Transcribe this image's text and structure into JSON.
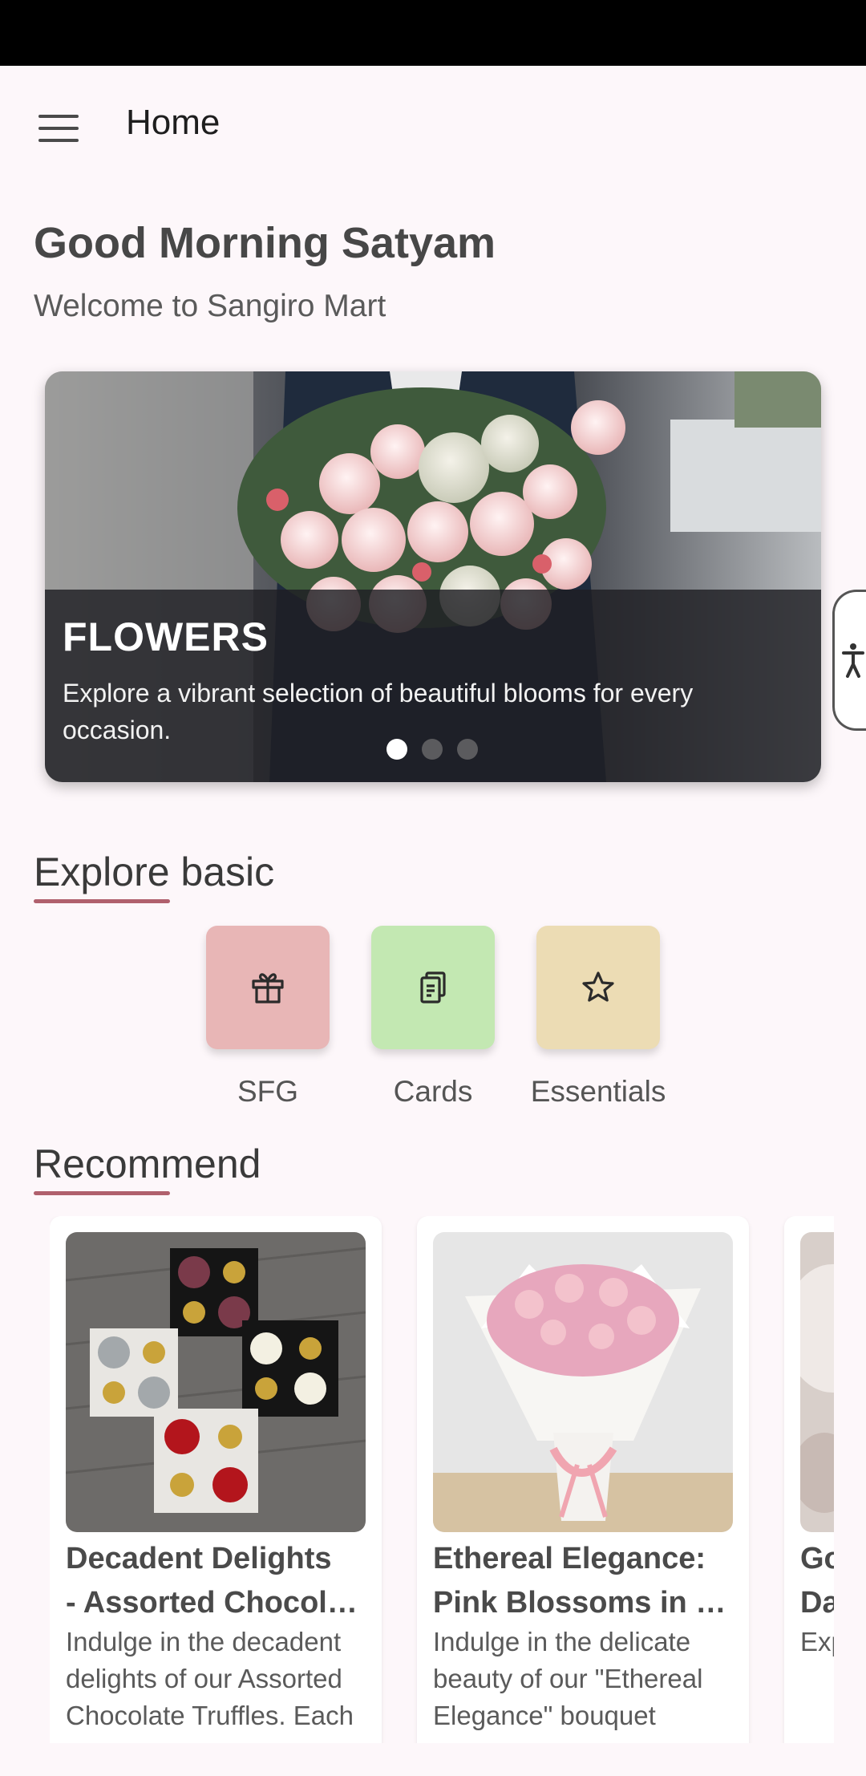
{
  "app_bar": {
    "title": "Home",
    "menu_icon": "hamburger-menu-icon"
  },
  "header": {
    "greeting": "Good Morning Satyam",
    "subtitle": "Welcome to Sangiro Mart"
  },
  "banner": {
    "title": "FLOWERS",
    "description": "Explore a vibrant selection of beautiful blooms for every occasion.",
    "slide_count": 3,
    "active_slide": 1
  },
  "explore": {
    "title": "Explore basic",
    "items": [
      {
        "label": "SFG",
        "icon": "gift-icon",
        "color": "#e8b6b6"
      },
      {
        "label": "Cards",
        "icon": "clipboard-icon",
        "color": "#c3e8b2"
      },
      {
        "label": "Essentials",
        "icon": "star-icon",
        "color": "#ecdcb4"
      }
    ]
  },
  "recommend": {
    "title": "Recommend",
    "items": [
      {
        "title_line1": "Decadent Delights",
        "title_line2": "- Assorted Chocolate Truffles",
        "description": "Indulge in the decadent delights of our Assorted Chocolate Truffles. Each"
      },
      {
        "title_line1": "Ethereal Elegance:",
        "title_line2": "Pink Blossoms in White",
        "description": "Indulge in the delicate beauty of our \"Ethereal Elegance\" bouquet"
      },
      {
        "title_line1": "Go",
        "title_line2": "Da",
        "description": "Exp blis Ch"
      }
    ]
  },
  "colors": {
    "background": "#fdf7fa",
    "accent_underline": "#b0606d",
    "status_bar": "#000000"
  }
}
